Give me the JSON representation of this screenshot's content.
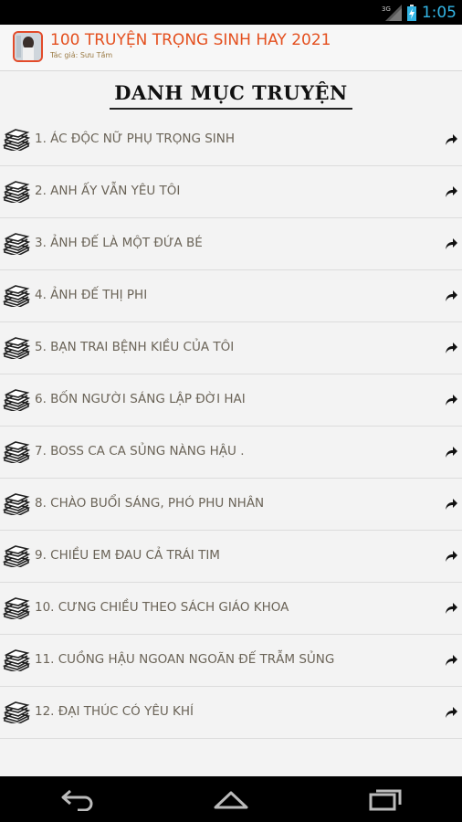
{
  "status_bar": {
    "network_label": "3G",
    "time": "1:05"
  },
  "app_bar": {
    "title": "100 TRUYỆN TRỌNG SINH HAY 2021",
    "subtitle": "Tác giả: Sưu Tầm"
  },
  "heading": "DANH MỤC TRUYỆN",
  "stories": [
    {
      "label": "1. ÁC ĐỘC NỮ PHỤ TRỌNG SINH"
    },
    {
      "label": "2. ANH ẤY VẪN YÊU TÔI"
    },
    {
      "label": "3. ẢNH ĐẾ LÀ MỘT ĐỨA BÉ"
    },
    {
      "label": "4. ẢNH ĐẾ THỊ PHI"
    },
    {
      "label": "5. BẠN TRAI BỆNH KIỀU CỦA TÔI"
    },
    {
      "label": "6. BỐN NGƯỜI SÁNG LẬP ĐỜI HAI"
    },
    {
      "label": "7. BOSS CA CA SỦNG NÀNG HẬU ."
    },
    {
      "label": "8. CHÀO BUỔI SÁNG, PHÓ PHU NHÂN"
    },
    {
      "label": "9. CHIỀU EM ĐAU CẢ TRÁI TIM"
    },
    {
      "label": "10. CƯNG CHIỀU THEO SÁCH GIÁO KHOA"
    },
    {
      "label": "11. CUỒNG HẬU NGOAN NGOÃN ĐẾ TRẪM SỦNG"
    },
    {
      "label": "12. ĐẠI THÚC CÓ YÊU KHÍ"
    }
  ],
  "icons": {
    "book": "book-stack-icon",
    "arrow": "share-arrow-icon",
    "back": "back-icon",
    "home": "home-icon",
    "recents": "recents-icon"
  },
  "colors": {
    "title": "#e4501f",
    "accent": "#33b5e5",
    "row_text": "#6b6458"
  }
}
